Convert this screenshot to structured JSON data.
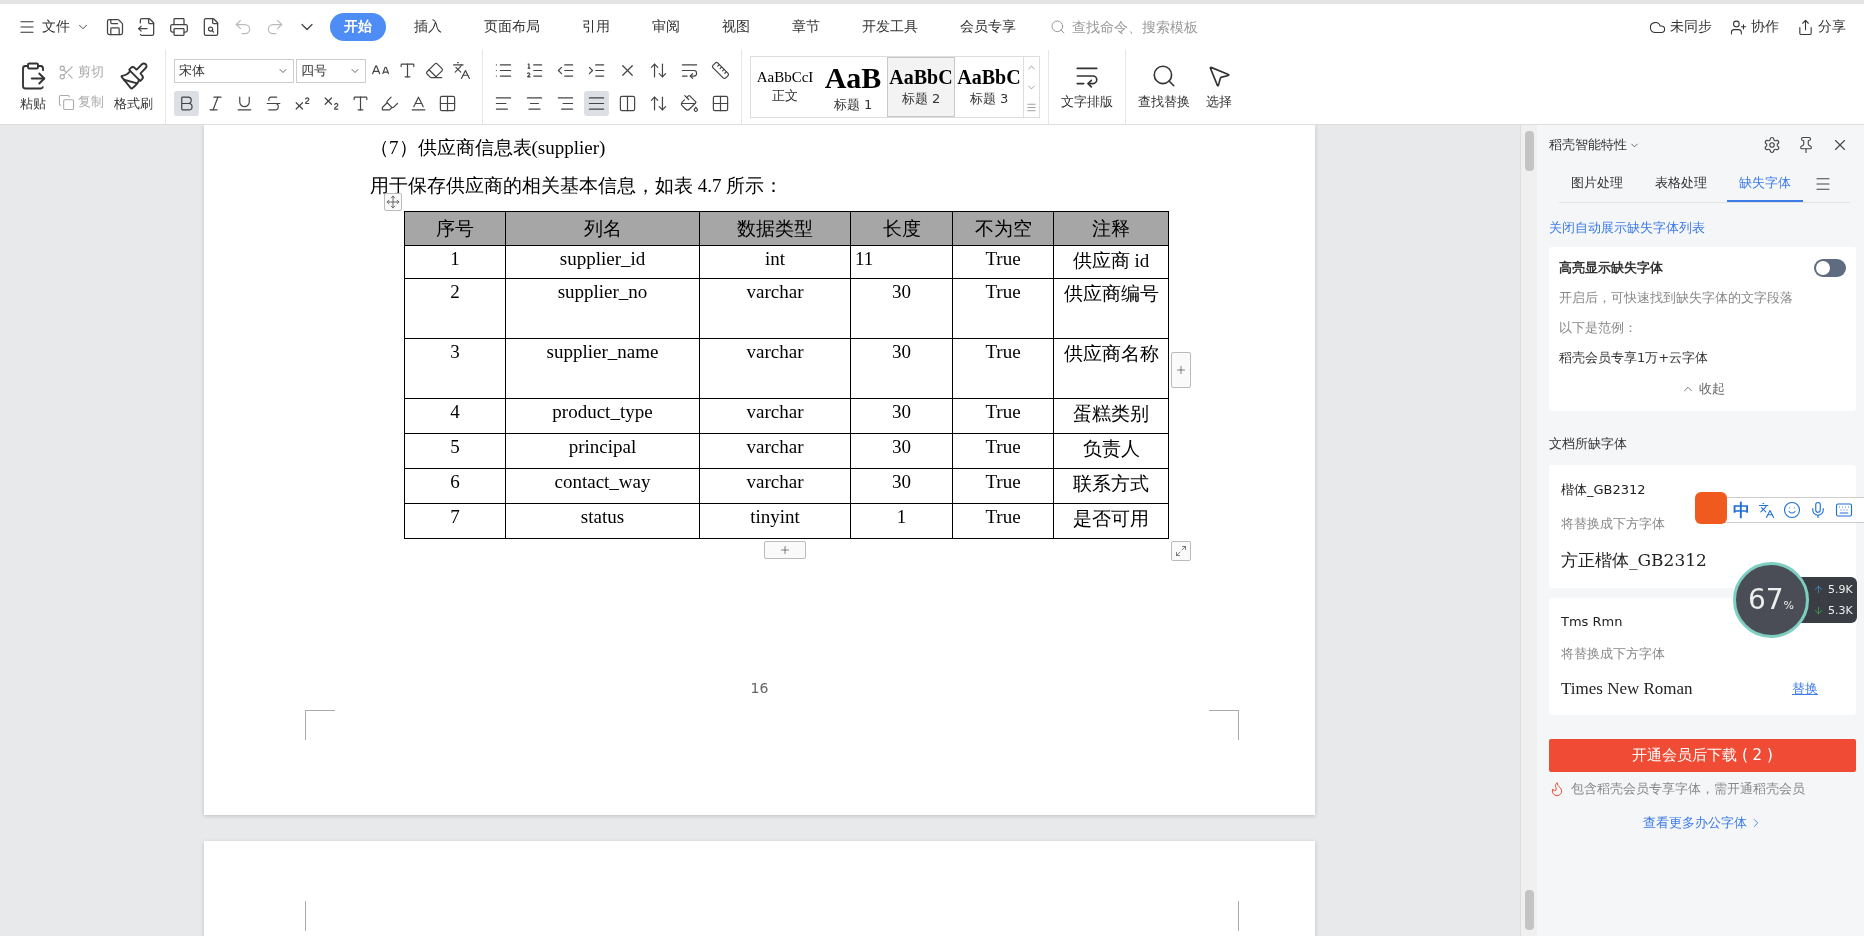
{
  "menu": {
    "file": "文件",
    "tabs": [
      {
        "label": "开始",
        "selected": true
      },
      {
        "label": "插入",
        "selected": false
      },
      {
        "label": "页面布局",
        "selected": false
      },
      {
        "label": "引用",
        "selected": false
      },
      {
        "label": "审阅",
        "selected": false
      },
      {
        "label": "视图",
        "selected": false
      },
      {
        "label": "章节",
        "selected": false
      },
      {
        "label": "开发工具",
        "selected": false
      },
      {
        "label": "会员专享",
        "selected": false
      }
    ],
    "search": {
      "placeholder": "查找命令、搜索模板"
    },
    "actions": [
      {
        "kind": "sync",
        "label": "未同步"
      },
      {
        "kind": "collab",
        "label": "协作"
      },
      {
        "kind": "share",
        "label": "分享"
      }
    ]
  },
  "ribbon": {
    "paste": "粘贴",
    "cut": {
      "label": "剪切",
      "disabled": true
    },
    "copy": {
      "label": "复制",
      "disabled": true
    },
    "format_painter": "格式刷",
    "font": {
      "name": "宋体",
      "size": "四号"
    },
    "bold": {
      "selected": true
    },
    "alignments": [
      {
        "kind": "left",
        "selected": false
      },
      {
        "kind": "center",
        "selected": false
      },
      {
        "kind": "right",
        "selected": false
      },
      {
        "kind": "justify",
        "selected": true
      },
      {
        "kind": "distributed",
        "selected": false
      }
    ],
    "styles": [
      {
        "kind": "normal",
        "sample": "AaBbCcI",
        "label": "正文",
        "selected": false
      },
      {
        "kind": "h1",
        "sample": "AaB",
        "label": "标题 1",
        "selected": false
      },
      {
        "kind": "h2",
        "sample": "AaBbC",
        "label": "标题 2",
        "selected": true
      },
      {
        "kind": "h3",
        "sample": "AaBbC",
        "label": "标题 3",
        "selected": false
      }
    ],
    "text_layout": "文字排版",
    "find_replace": "查找替换",
    "select": "选择"
  },
  "document": {
    "heading": "（7）供应商信息表(supplier)",
    "intro": "用于保存供应商的相关基本信息，如表 4.7 所示：",
    "table": {
      "columns": [
        "序号",
        "列名",
        "数据类型",
        "长度",
        "不为空",
        "注释"
      ],
      "rows": [
        [
          "1",
          "supplier_id",
          "int",
          "11",
          "True",
          "供应商 id"
        ],
        [
          "2",
          "supplier_no",
          "varchar",
          "30",
          "True",
          "供应商编号"
        ],
        [
          "3",
          "supplier_name",
          "varchar",
          "30",
          "True",
          "供应商名称"
        ],
        [
          "4",
          "product_type",
          "varchar",
          "30",
          "True",
          "蛋糕类别"
        ],
        [
          "5",
          "principal",
          "varchar",
          "30",
          "True",
          "负责人"
        ],
        [
          "6",
          "contact_way",
          "varchar",
          "30",
          "True",
          "联系方式"
        ],
        [
          "7",
          "status",
          "tinyint",
          "1",
          "True",
          "是否可用"
        ]
      ]
    },
    "page_number": "16"
  },
  "panel": {
    "title": "稻壳智能特性",
    "tabs": [
      {
        "label": "图片处理",
        "selected": false
      },
      {
        "label": "表格处理",
        "selected": false
      },
      {
        "label": "缺失字体",
        "selected": true
      }
    ],
    "close_link": "关闭自动展示缺失字体列表",
    "highlight": {
      "label": "高亮显示缺失字体",
      "on": false,
      "description": "开启后，可快速找到缺失字体的文字段落",
      "example_label": "以下是范例：",
      "example": "稻壳会员专享1万+云字体",
      "collapse": "收起"
    },
    "section_title": "文档所缺字体",
    "fonts": [
      {
        "name": "楷体_GB2312",
        "hint": "将替换成下方字体",
        "replacement": "方正楷体_GB2312",
        "kind": "kai"
      },
      {
        "name": "Tms Rmn",
        "hint": "将替换成下方字体",
        "replacement": "Times New Roman",
        "kind": "times",
        "action": "替换"
      }
    ],
    "download_button": "开通会员后下载 ( 2 )",
    "note": "包含稻壳会员专享字体，需开通稻壳会员",
    "more_link": "查看更多办公字体"
  },
  "ime": {
    "mode": "中"
  },
  "net_monitor": {
    "percent": "67",
    "unit": "%",
    "up": "5.9K",
    "down": "5.3K"
  }
}
